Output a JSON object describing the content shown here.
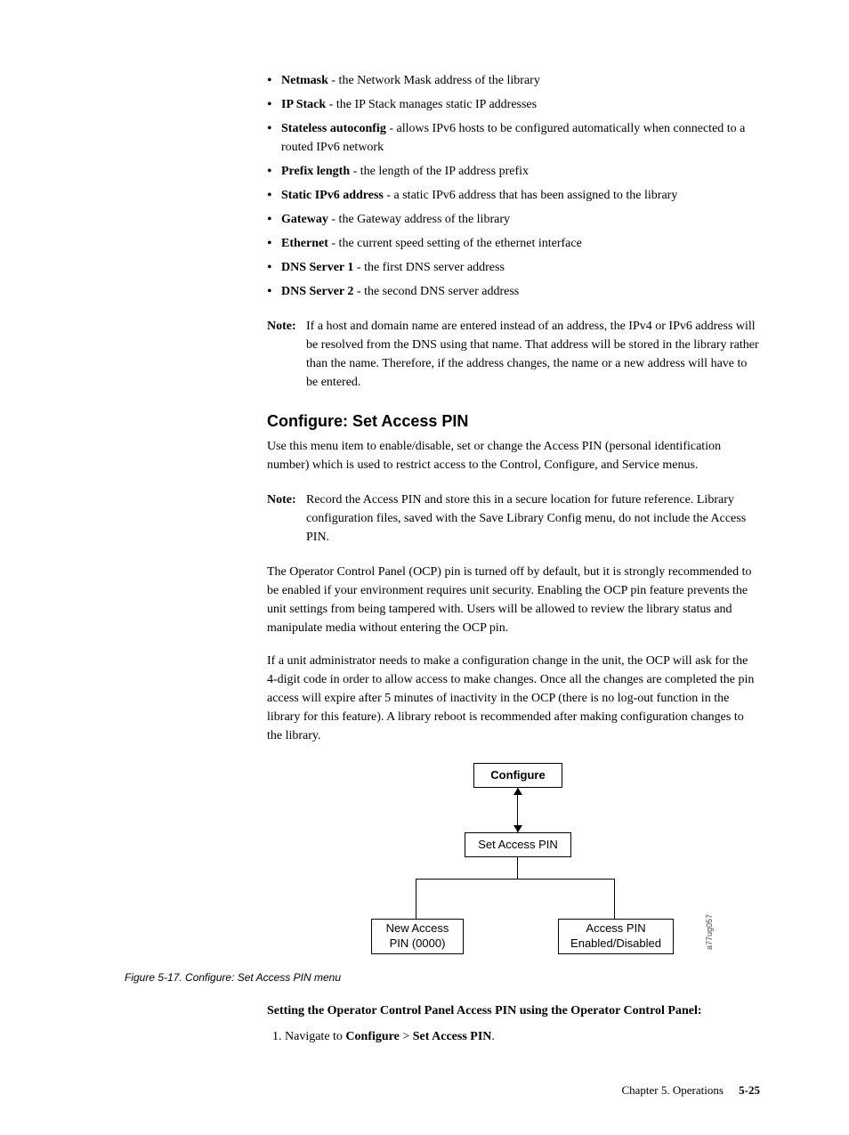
{
  "bullets": [
    {
      "term": "Netmask",
      "desc": " - the Network Mask address of the library"
    },
    {
      "term": "IP Stack",
      "desc": " - the IP Stack manages static IP addresses"
    },
    {
      "term": "Stateless autoconfig",
      "desc": " - allows IPv6 hosts to be configured automatically when connected to a routed IPv6 network"
    },
    {
      "term": "Prefix length",
      "desc": " - the length of the IP address prefix"
    },
    {
      "term": "Static IPv6 address",
      "desc": " - a static IPv6 address that has been assigned to the library"
    },
    {
      "term": "Gateway",
      "desc": " - the Gateway address of the library"
    },
    {
      "term": "Ethernet",
      "desc": " - the current speed setting of the ethernet interface"
    },
    {
      "term": "DNS Server 1",
      "desc": " - the first DNS server address"
    },
    {
      "term": "DNS Server 2",
      "desc": " - the second DNS server address"
    }
  ],
  "note1": {
    "label": "Note:",
    "text": "If a host and domain name are entered instead of an address, the IPv4 or IPv6 address will be resolved from the DNS using that name. That address will be stored in the library rather than the name. Therefore, if the address changes, the name or a new address will have to be entered."
  },
  "section": {
    "heading": "Configure: Set Access PIN",
    "para1": "Use this menu item to enable/disable, set or change the Access PIN (personal identification number) which is used to restrict access to the Control, Configure, and Service menus."
  },
  "note2": {
    "label": "Note:",
    "text": "Record the Access PIN and store this in a secure location for future reference. Library configuration files, saved with the Save Library Config menu, do not include the Access PIN."
  },
  "para2": "The Operator Control Panel (OCP) pin is turned off by default, but it is strongly recommended to be enabled if your environment requires unit security. Enabling the OCP pin feature prevents the unit settings from being tampered with. Users will be allowed to review the library status and manipulate media without entering the OCP pin.",
  "para3": "If a unit administrator needs to make a configuration change in the unit, the OCP will ask for the 4-digit code in order to allow access to make changes. Once all the changes are completed the pin access will expire after 5 minutes of inactivity in the OCP (there is no log-out function in the library for this feature). A library reboot is recommended after making configuration changes to the library.",
  "diagram": {
    "top": "Configure",
    "mid": "Set Access PIN",
    "bl_line1": "New Access",
    "bl_line2": "PIN (0000)",
    "br_line1": "Access PIN",
    "br_line2": "Enabled/Disabled",
    "sidelabel": "a77ug057"
  },
  "figure_caption": "Figure 5-17. Configure: Set Access PIN menu",
  "subheading": "Setting the Operator Control Panel Access PIN using the Operator Control Panel:",
  "step1_pre": "Navigate to ",
  "step1_b1": "Configure",
  "step1_sep": " > ",
  "step1_b2": "Set Access PIN",
  "step1_post": ".",
  "footer": {
    "chapter": "Chapter 5. Operations",
    "page": "5-25"
  }
}
